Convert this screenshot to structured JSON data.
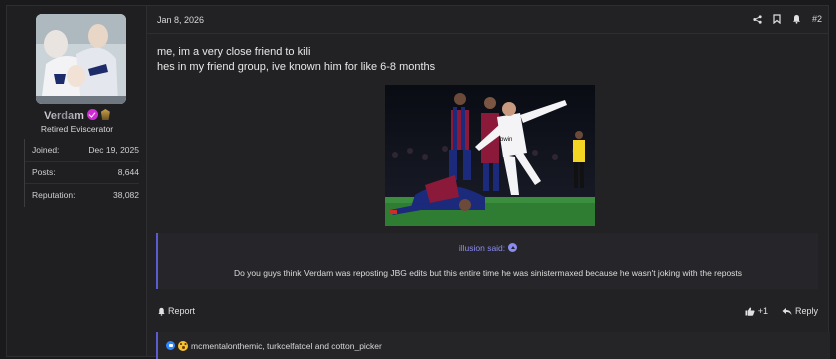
{
  "user": {
    "name": "Verdam",
    "title": "Retired Eviscerator",
    "stats": [
      {
        "label": "Joined:",
        "value": "Dec 19, 2025"
      },
      {
        "label": "Posts:",
        "value": "8,644"
      },
      {
        "label": "Reputation:",
        "value": "38,082"
      }
    ]
  },
  "post": {
    "date": "Jan 8, 2026",
    "number": "#2",
    "lines": [
      "me, im a very close friend to kili",
      "hes in my friend group, ive known him for like 6-8 months"
    ],
    "quote": {
      "author": "illusion said:",
      "text": "Do you guys think Verdam was reposting JBG edits but this entire time he was sinistermaxed because he wasn't joking with the reposts"
    },
    "actions": {
      "report": "Report",
      "react_count": "+1",
      "reply": "Reply"
    },
    "reactions_text": "mcmentalonthemic, turkcelfatcel and cotton_picker"
  },
  "colors": {
    "accent": "#5a5bd0",
    "quote_author": "#8a8cf0",
    "verified": "#d12bd6"
  },
  "icons": [
    "share-icon",
    "bookmark-icon",
    "bell-icon",
    "thumbs-up-icon",
    "reply-icon",
    "quote-up-arrow-icon",
    "like-reaction-icon",
    "wow-reaction-icon"
  ]
}
